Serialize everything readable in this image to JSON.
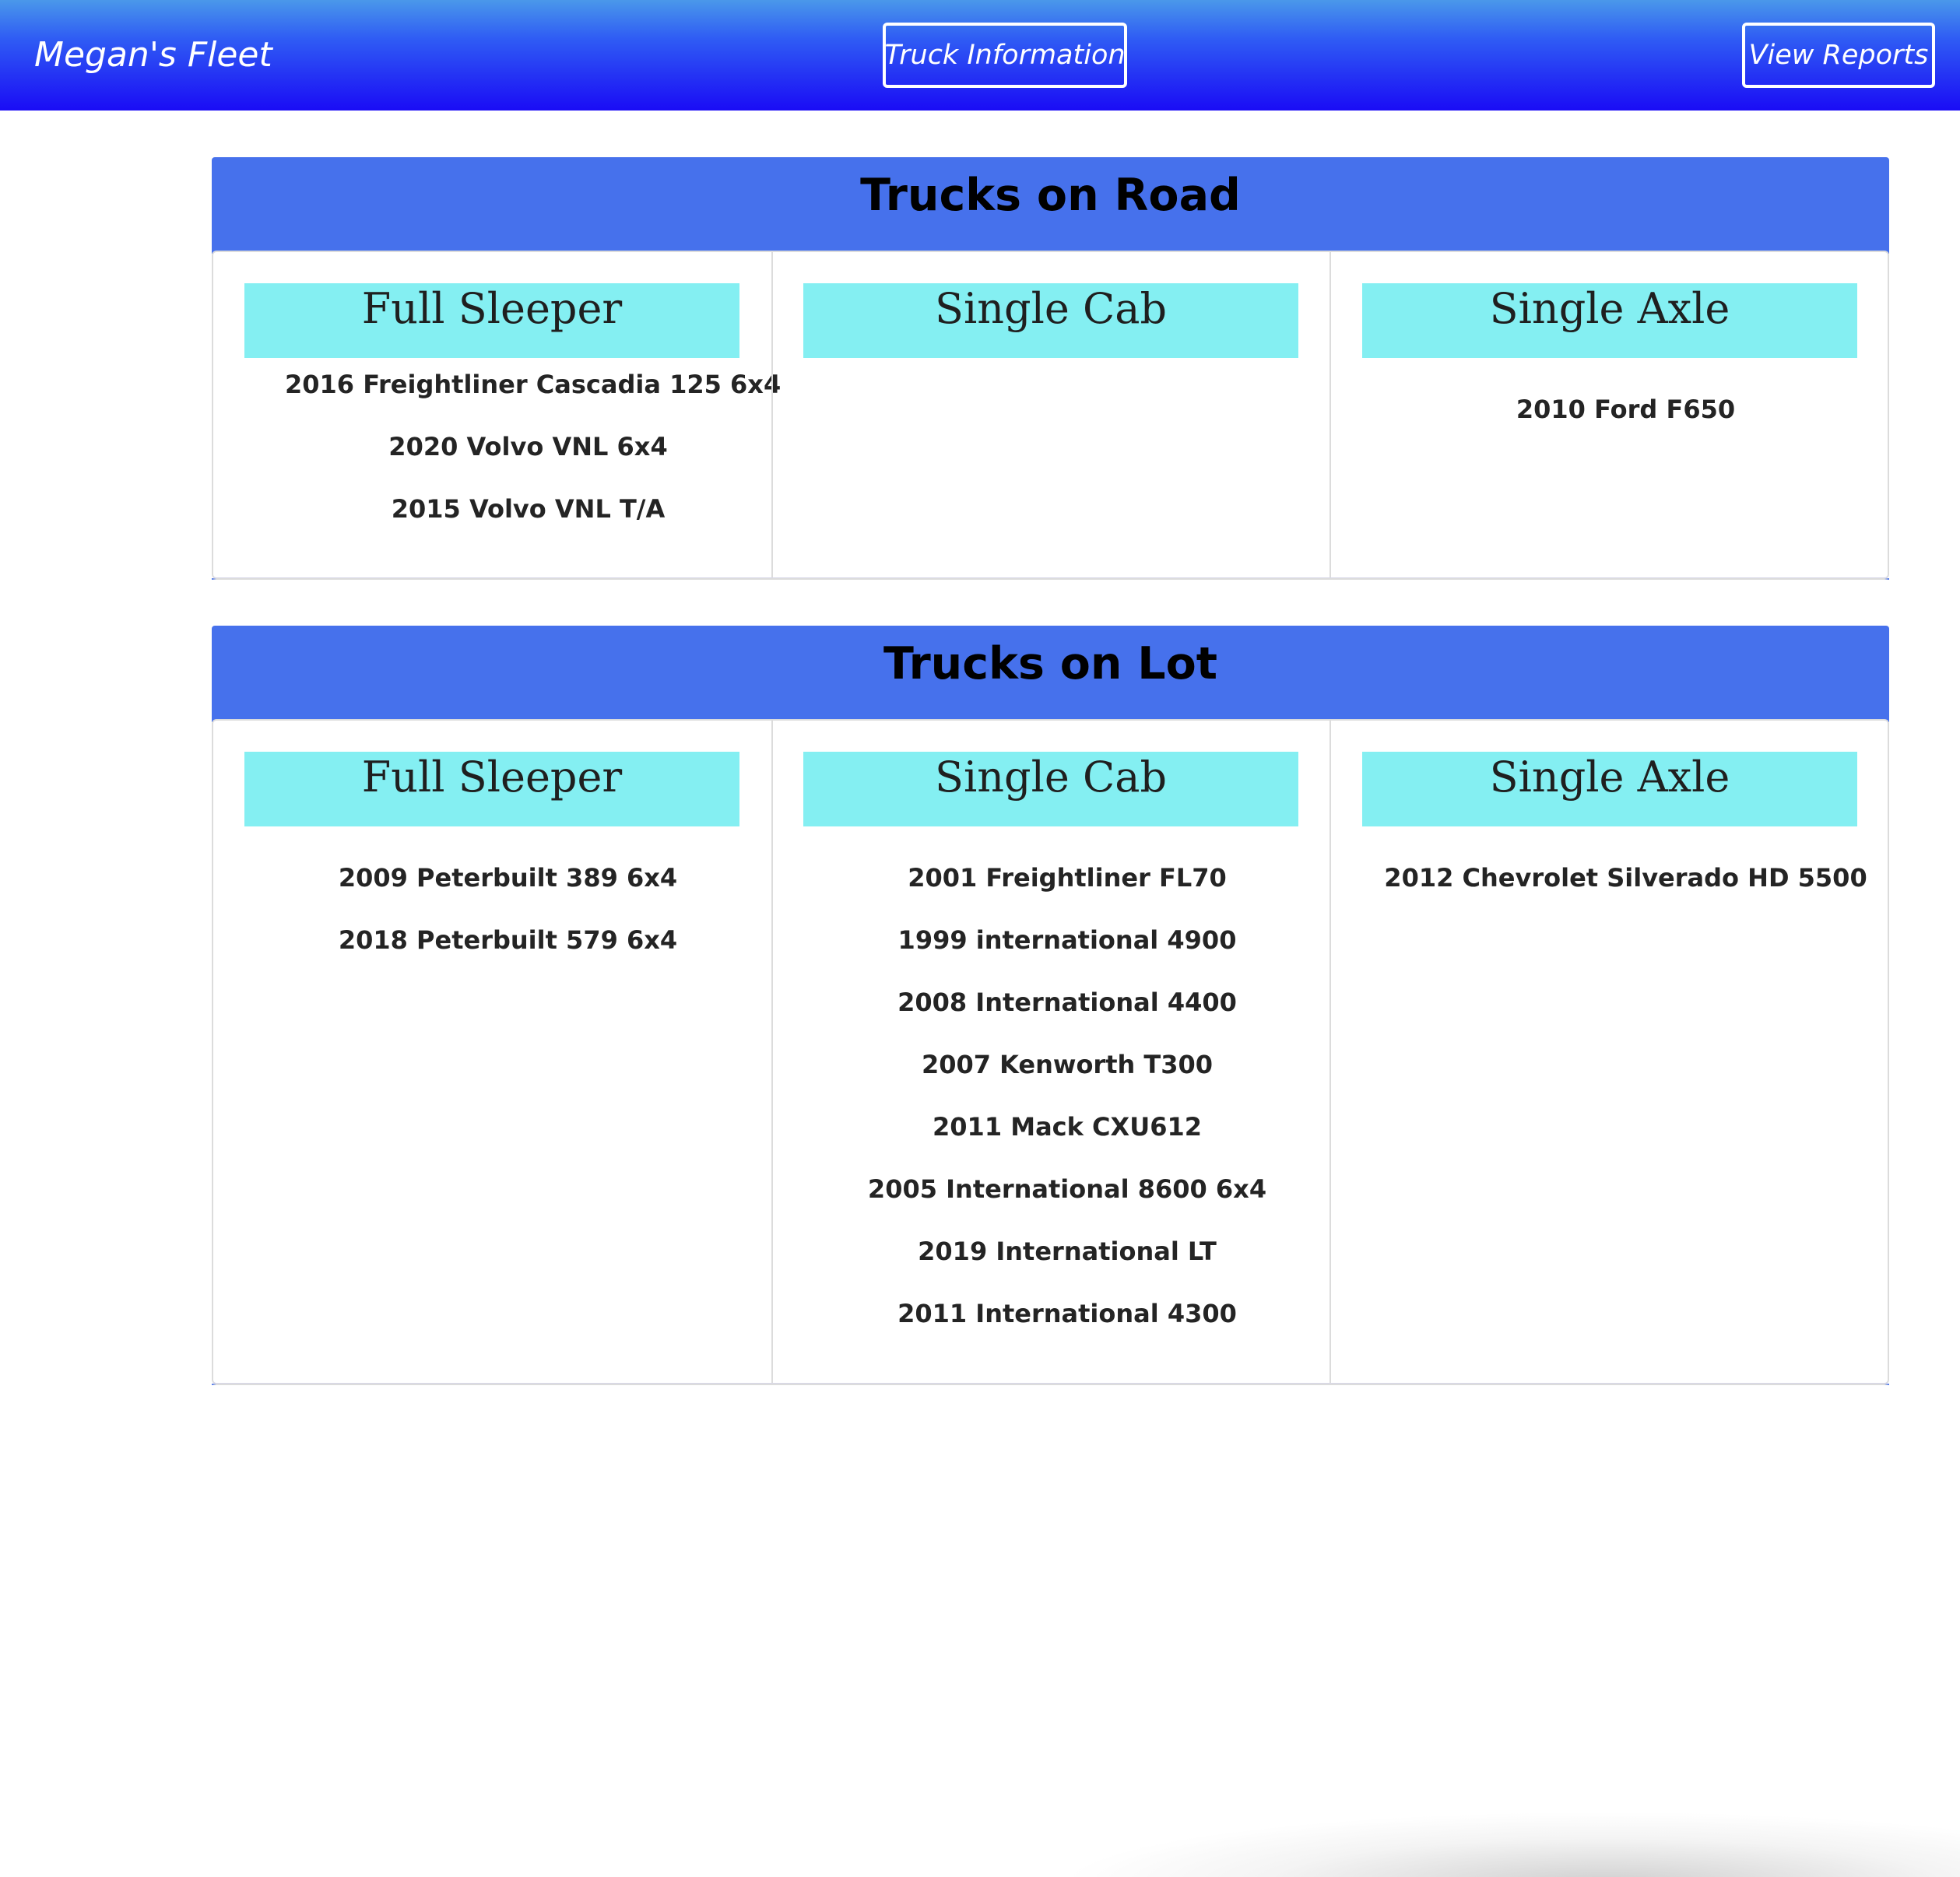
{
  "navbar": {
    "brand": "Megan's Fleet",
    "truck_information": "Truck Information",
    "view_reports": "View Reports"
  },
  "colors": {
    "navbar_top": "#4a98ea",
    "navbar_bottom": "#1a0cf5",
    "section_header": "#4671ec",
    "category_header": "#84eff2"
  },
  "road": {
    "title": "Trucks on Road",
    "full_sleeper": {
      "label": "Full Sleeper",
      "trucks": [
        "2016 Freightliner Cascadia 125 6x4",
        "2020 Volvo VNL 6x4",
        "2015 Volvo VNL T/A"
      ]
    },
    "single_cab": {
      "label": "Single Cab",
      "trucks": []
    },
    "single_axle": {
      "label": "Single Axle",
      "trucks": [
        "2010 Ford F650"
      ]
    }
  },
  "lot": {
    "title": "Trucks on Lot",
    "full_sleeper": {
      "label": "Full Sleeper",
      "trucks": [
        "2009 Peterbuilt 389 6x4",
        "2018 Peterbuilt 579 6x4"
      ]
    },
    "single_cab": {
      "label": "Single Cab",
      "trucks": [
        "2001 Freightliner FL70",
        "1999 international 4900",
        "2008 International 4400",
        "2007 Kenworth T300",
        "2011 Mack CXU612",
        "2005 International 8600 6x4",
        "2019 International LT",
        "2011 International 4300"
      ]
    },
    "single_axle": {
      "label": "Single Axle",
      "trucks": [
        "2012 Chevrolet Silverado HD 5500"
      ]
    }
  }
}
